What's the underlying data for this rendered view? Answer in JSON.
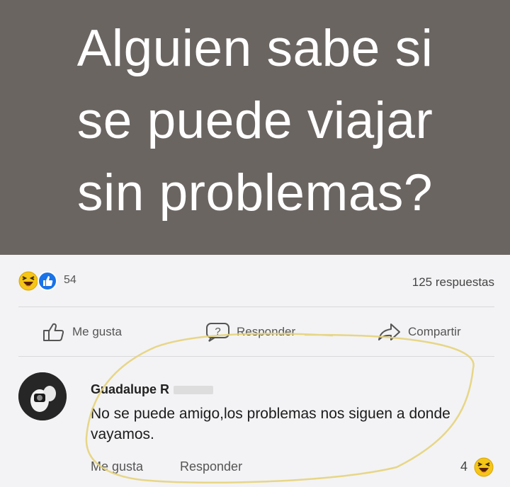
{
  "banner": {
    "lines": [
      "Alguien sabe si",
      "se puede viajar",
      "sin problemas?"
    ],
    "background": "#6b6562",
    "text_color": "#ffffff"
  },
  "post_stats": {
    "reaction_icons": [
      "laughing-emoji-icon",
      "like-badge-icon"
    ],
    "like_count": "54",
    "reply_count": "125 respuestas"
  },
  "post_actions": {
    "like": {
      "label": "Me gusta",
      "icon": "thumbs-up-icon"
    },
    "reply": {
      "label": "Responder",
      "icon": "question-bubble-icon"
    },
    "share": {
      "label": "Compartir",
      "icon": "share-arrow-icon"
    }
  },
  "comment": {
    "author": "Guadalupe R",
    "text": "No se puede amigo,los problemas nos siguen a donde vayamos.",
    "like_label": "Me gusta",
    "reply_label": "Responder",
    "reaction_count": "4",
    "reaction_icon": "laughing-emoji-icon"
  },
  "colors": {
    "panel_bg": "#f3f3f5",
    "circle_highlight": "#e6d37a",
    "like_blue": "#1a73e8",
    "emoji_yellow": "#f5c518"
  }
}
